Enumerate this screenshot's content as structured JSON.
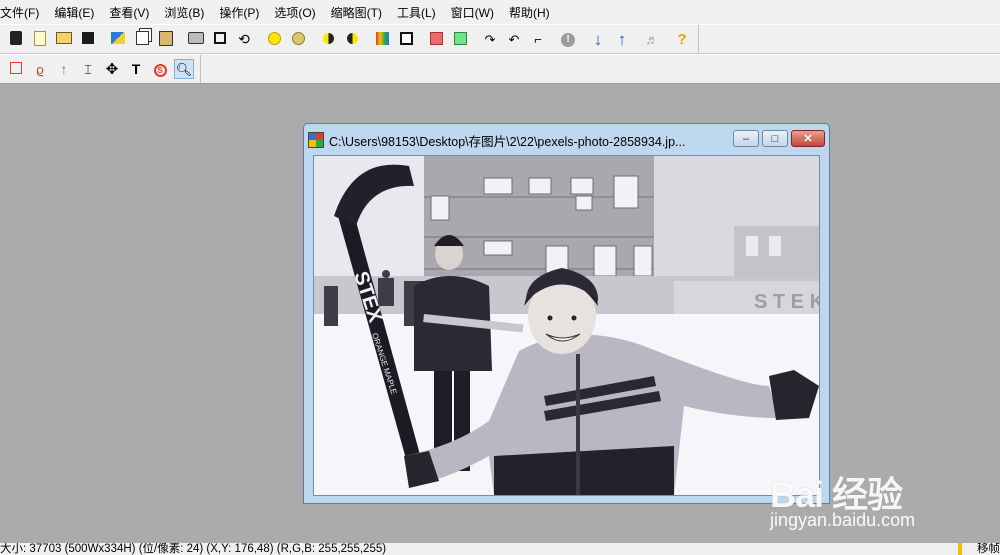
{
  "menu": [
    {
      "label": "文件(F)"
    },
    {
      "label": "编辑(E)"
    },
    {
      "label": "查看(V)"
    },
    {
      "label": "浏览(B)"
    },
    {
      "label": "操作(P)"
    },
    {
      "label": "选项(O)"
    },
    {
      "label": "缩略图(T)"
    },
    {
      "label": "工具(L)"
    },
    {
      "label": "窗口(W)"
    },
    {
      "label": "帮助(H)"
    }
  ],
  "toolbar_main": [
    {
      "icon": "open-folder-icon"
    },
    {
      "icon": "new-file-icon"
    },
    {
      "icon": "open-file-icon"
    },
    {
      "icon": "save-icon"
    },
    {
      "icon": "acquire-icon"
    },
    {
      "icon": "copy-icon"
    },
    {
      "icon": "paste-icon"
    },
    {
      "icon": "print-icon"
    },
    {
      "icon": "fit-window-icon"
    },
    {
      "icon": "undo-icon"
    },
    {
      "icon": "brightness-up-icon"
    },
    {
      "icon": "brightness-down-icon"
    },
    {
      "icon": "contrast-up-icon"
    },
    {
      "icon": "contrast-down-icon"
    },
    {
      "icon": "color-palette-icon"
    },
    {
      "icon": "grayscale-icon"
    },
    {
      "icon": "red-channel-icon"
    },
    {
      "icon": "green-channel-icon"
    },
    {
      "icon": "rotate-right-icon"
    },
    {
      "icon": "rotate-left-icon"
    },
    {
      "icon": "crop-icon"
    },
    {
      "icon": "info-icon"
    },
    {
      "icon": "previous-icon"
    },
    {
      "icon": "next-icon"
    },
    {
      "icon": "sound-icon"
    },
    {
      "icon": "help-icon"
    }
  ],
  "toolbar_draw": [
    {
      "icon": "rectangle-tool-icon"
    },
    {
      "icon": "lasso-tool-icon"
    },
    {
      "icon": "arrow-tool-icon"
    },
    {
      "icon": "line-tool-icon"
    },
    {
      "icon": "move-tool-icon"
    },
    {
      "icon": "text-tool-icon"
    },
    {
      "icon": "stamp-tool-icon"
    },
    {
      "icon": "zoom-tool-icon"
    }
  ],
  "child_window": {
    "title": "C:\\Users\\98153\\Desktop\\存图片\\2\\22\\pexels-photo-2858934.jp...",
    "minimize": "–",
    "maximize": "□",
    "close": "✕",
    "image": {
      "board_text": "S T E K",
      "stick_text": "STEX",
      "stick_subtext": "ORANGE MAPLE"
    }
  },
  "statusbar": {
    "text": "大小: 37703 (500Wx334H) (位/像素: 24) (X,Y: 176,48) (R,G,B: 255,255,255)",
    "right": "移帧"
  },
  "watermark": {
    "main": "Bai 经验",
    "sub": "jingyan.baidu.com"
  },
  "colors": {
    "desktop": "#ababab",
    "title_active": "#bdd7ef",
    "close_btn": "#c5443a"
  }
}
